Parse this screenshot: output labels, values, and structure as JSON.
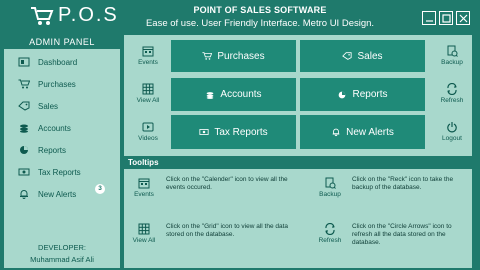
{
  "app": {
    "logo_text": "P.O.S",
    "title": "POINT OF SALES SOFTWARE",
    "subtitle": "Ease of use. User Friendly Interface. Metro UI Design."
  },
  "sidebar": {
    "title": "ADMIN PANEL",
    "items": [
      {
        "label": "Dashboard",
        "icon": "dashboard-icon"
      },
      {
        "label": "Purchases",
        "icon": "cart-icon"
      },
      {
        "label": "Sales",
        "icon": "tag-icon"
      },
      {
        "label": "Accounts",
        "icon": "coins-icon"
      },
      {
        "label": "Reports",
        "icon": "pie-chart-icon"
      },
      {
        "label": "Tax Reports",
        "icon": "money-icon"
      },
      {
        "label": "New Alerts",
        "icon": "bell-icon"
      }
    ],
    "alerts_badge": "3",
    "developer_label": "DEVELOPER:",
    "developer_name": "Muhammad Asif Ali"
  },
  "left_shortcuts": [
    {
      "label": "Events",
      "icon": "calendar-icon"
    },
    {
      "label": "View All",
      "icon": "grid-icon"
    },
    {
      "label": "Videos",
      "icon": "video-icon"
    }
  ],
  "right_shortcuts": [
    {
      "label": "Backup",
      "icon": "backup-icon"
    },
    {
      "label": "Refresh",
      "icon": "refresh-icon"
    },
    {
      "label": "Logout",
      "icon": "logout-icon"
    }
  ],
  "tiles": [
    {
      "label": "Purchases",
      "icon": "cart-icon"
    },
    {
      "label": "Sales",
      "icon": "tag-icon"
    },
    {
      "label": "Accounts",
      "icon": "coins-icon"
    },
    {
      "label": "Reports",
      "icon": "pie-chart-icon"
    },
    {
      "label": "Tax Reports",
      "icon": "money-icon"
    },
    {
      "label": "New Alerts",
      "icon": "bell-icon"
    }
  ],
  "tooltips": {
    "title": "Tooltips",
    "items": [
      {
        "icon_label": "Events",
        "text": "Click on the \"Calender\" icon to view all the events occured."
      },
      {
        "icon_label": "Backup",
        "text": "Click on the \"Reck\" icon to take the backup of the database."
      },
      {
        "icon_label": "View All",
        "text": "Click on the \"Grid\" icon to view all the data stored on the database."
      },
      {
        "icon_label": "Refresh",
        "text": "Click on the \"Circle Arrows\" icon to refresh all the data stored on the database."
      }
    ]
  },
  "colors": {
    "primary": "#1f7a6c",
    "tile": "#1f8a78",
    "panel": "#a8d8cc",
    "text_dark": "#0e5a4f"
  }
}
